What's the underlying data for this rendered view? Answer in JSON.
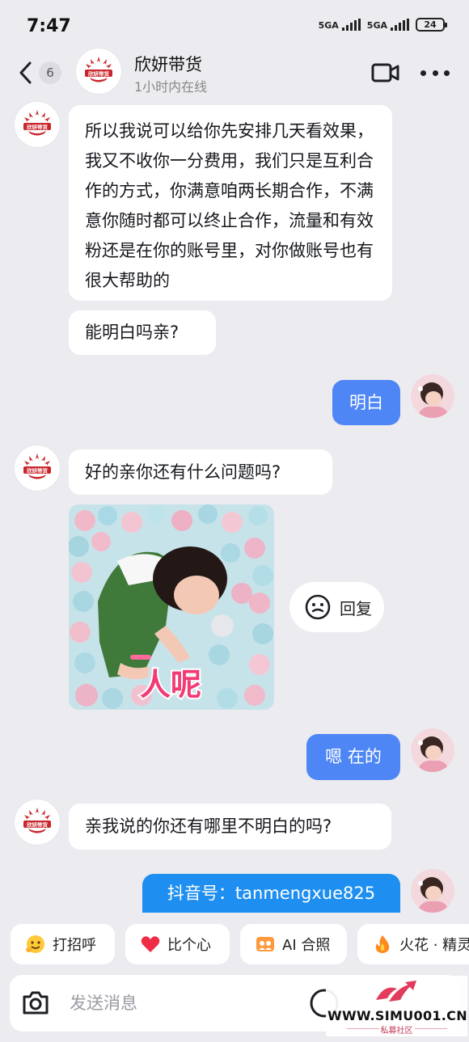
{
  "status_bar": {
    "time": "7:47",
    "network_1": "5GA",
    "network_2": "5GA",
    "battery": "24"
  },
  "header": {
    "unread_count": "6",
    "contact_name": "欣妍带货",
    "contact_status": "1小时内在线",
    "avatar_logo_text": "欣妍带货",
    "back_icon": "chevron-left-icon",
    "video_icon": "video-camera-icon",
    "more_icon": "more-dots-icon"
  },
  "messages": [
    {
      "side": "in",
      "text": "所以我说可以给你先安排几天看效果，我又不收你一分费用，我们只是互利合作的方式，你满意咱两长期合作，不满意你随时都可以终止合作，流量和有效粉还是在你的账号里，对你做账号也有很大帮助的"
    },
    {
      "side": "in",
      "text": "能明白吗亲?"
    },
    {
      "side": "out",
      "text": "明白"
    },
    {
      "side": "in",
      "text": "好的亲你还有什么问题吗?"
    },
    {
      "side": "in",
      "type": "sticker",
      "text": "人呢"
    },
    {
      "side": "out",
      "text": "嗯 在的"
    },
    {
      "side": "in",
      "text": "亲我说的你还有哪里不明白的吗?"
    },
    {
      "side": "out",
      "text": "抖音号：tanmengxue825"
    }
  ],
  "reply_button": {
    "label": "回复",
    "icon": "smiley-icon"
  },
  "quick_replies": [
    {
      "label": "打招呼",
      "icon": "wave-emoji-icon"
    },
    {
      "label": "比个心",
      "icon": "heart-icon"
    },
    {
      "label": "AI 合照",
      "icon": "photo-icon"
    },
    {
      "label": "火花 · 精灵",
      "icon": "spark-icon"
    }
  ],
  "input_bar": {
    "placeholder": "发送消息",
    "camera_icon": "camera-icon",
    "emoji_icon": "emoji-icon"
  },
  "watermark": {
    "site": "WWW.SIMU001.CN",
    "sub": "私募社区"
  },
  "colors": {
    "background": "#ececf0",
    "outgoing_bubble": "#4e86f5",
    "douyin_bubble": "#1e8ff0",
    "incoming_bubble": "#ffffff"
  }
}
